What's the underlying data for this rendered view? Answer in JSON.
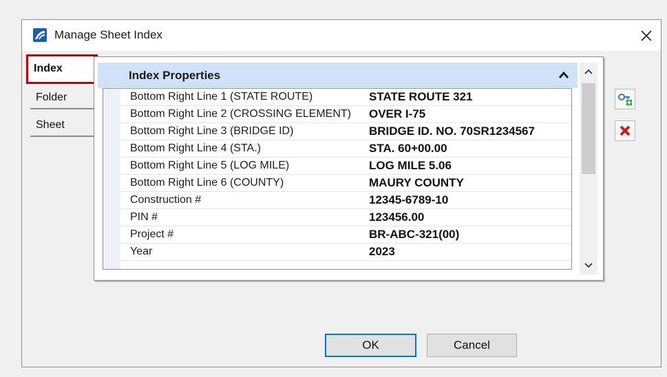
{
  "dialog": {
    "title": "Manage Sheet Index"
  },
  "tabs": [
    {
      "label": "Index",
      "active": true
    },
    {
      "label": "Folder",
      "active": false
    },
    {
      "label": "Sheet",
      "active": false
    }
  ],
  "panel": {
    "header": "Index Properties",
    "properties": [
      {
        "name": "Bottom Right Line 1 (STATE ROUTE)",
        "value": "STATE ROUTE 321"
      },
      {
        "name": "Bottom Right Line 2 (CROSSING ELEMENT)",
        "value": "OVER I-75"
      },
      {
        "name": "Bottom Right Line 3 (BRIDGE ID)",
        "value": "BRIDGE ID. NO. 70SR1234567"
      },
      {
        "name": "Bottom Right Line 4 (STA.)",
        "value": "STA. 60+00.00"
      },
      {
        "name": "Bottom Right Line 5 (LOG MILE)",
        "value": "LOG MILE 5.06"
      },
      {
        "name": "Bottom Right Line 6 (COUNTY)",
        "value": "MAURY COUNTY"
      },
      {
        "name": "Construction #",
        "value": "12345-6789-10"
      },
      {
        "name": "PIN #",
        "value": "123456.00"
      },
      {
        "name": "Project #",
        "value": "BR-ABC-321(00)"
      },
      {
        "name": "Year",
        "value": "2023"
      }
    ]
  },
  "buttons": {
    "ok": "OK",
    "cancel": "Cancel"
  },
  "colors": {
    "highlight": "#c00000",
    "header_bg": "#cfe2f7",
    "default_button_border": "#0078d7",
    "delete_icon": "#d11a1a"
  }
}
